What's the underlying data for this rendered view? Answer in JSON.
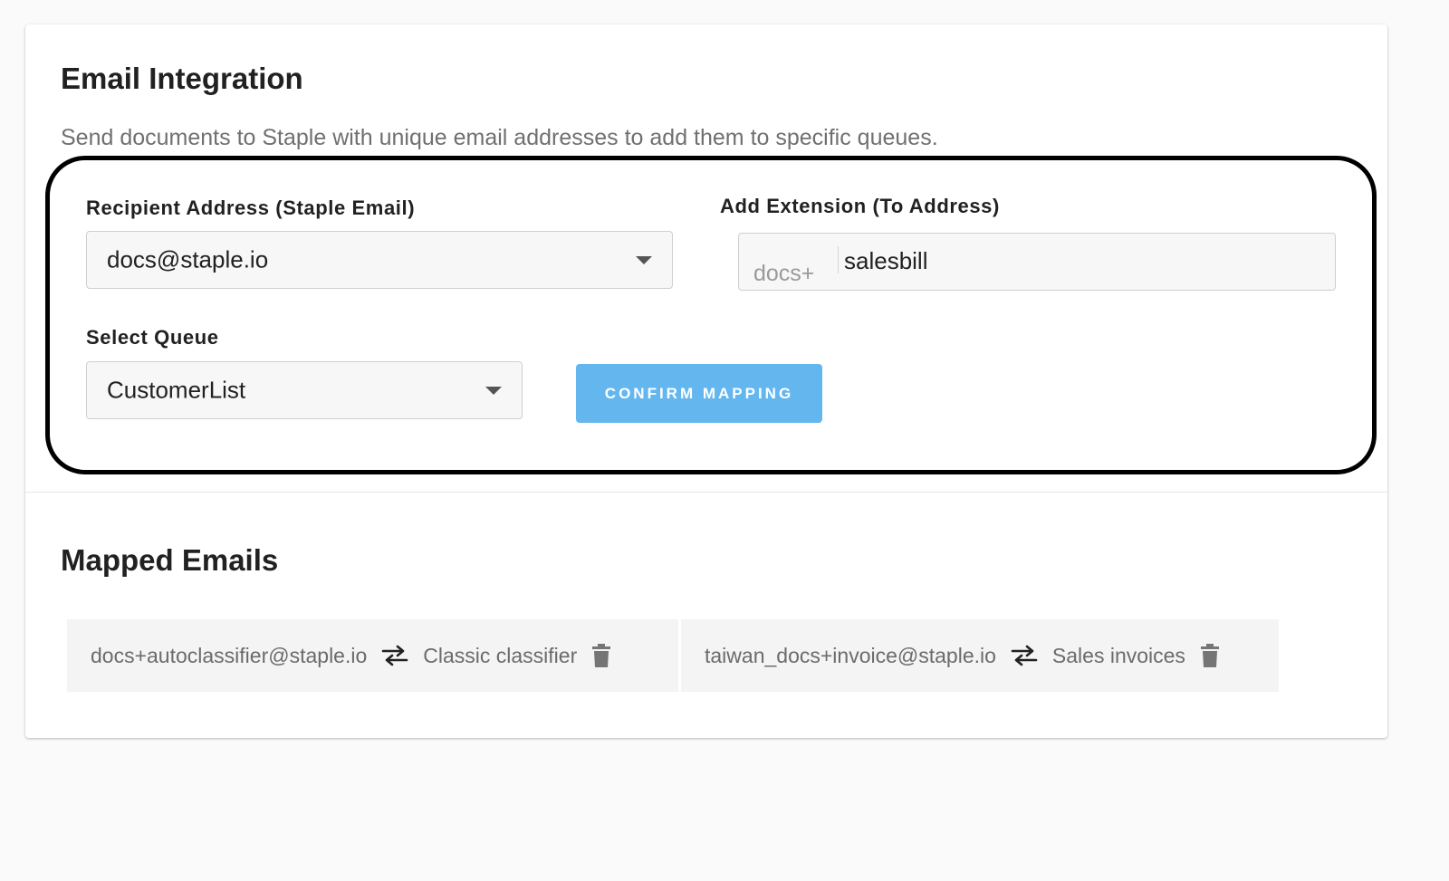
{
  "integration": {
    "title": "Email Integration",
    "description": "Send documents to Staple with unique email addresses to add them to specific queues."
  },
  "form": {
    "recipient": {
      "label": "Recipient Address (Staple Email)",
      "value": "docs@staple.io",
      "icon": "chevron-down-icon"
    },
    "extension": {
      "label": "Add Extension (To Address)",
      "prefix": "docs+",
      "value": "salesbill"
    },
    "queue": {
      "label": "Select Queue",
      "value": "CustomerList",
      "icon": "chevron-down-icon"
    },
    "confirm_label": "CONFIRM MAPPING",
    "confirm_color": "#64b7ee"
  },
  "mapped": {
    "title": "Mapped Emails",
    "items": [
      {
        "address": "docs+autoclassifier@staple.io",
        "queue": "Classic classifier",
        "icons": [
          "swap-arrows-icon",
          "trash-icon"
        ]
      },
      {
        "address": "taiwan_docs+invoice@staple.io",
        "queue": "Sales invoices",
        "icons": [
          "swap-arrows-icon",
          "trash-icon"
        ]
      }
    ]
  },
  "colors": {
    "highlight_border": "#000000",
    "card_background": "#ffffff",
    "page_background": "#fafafa"
  }
}
